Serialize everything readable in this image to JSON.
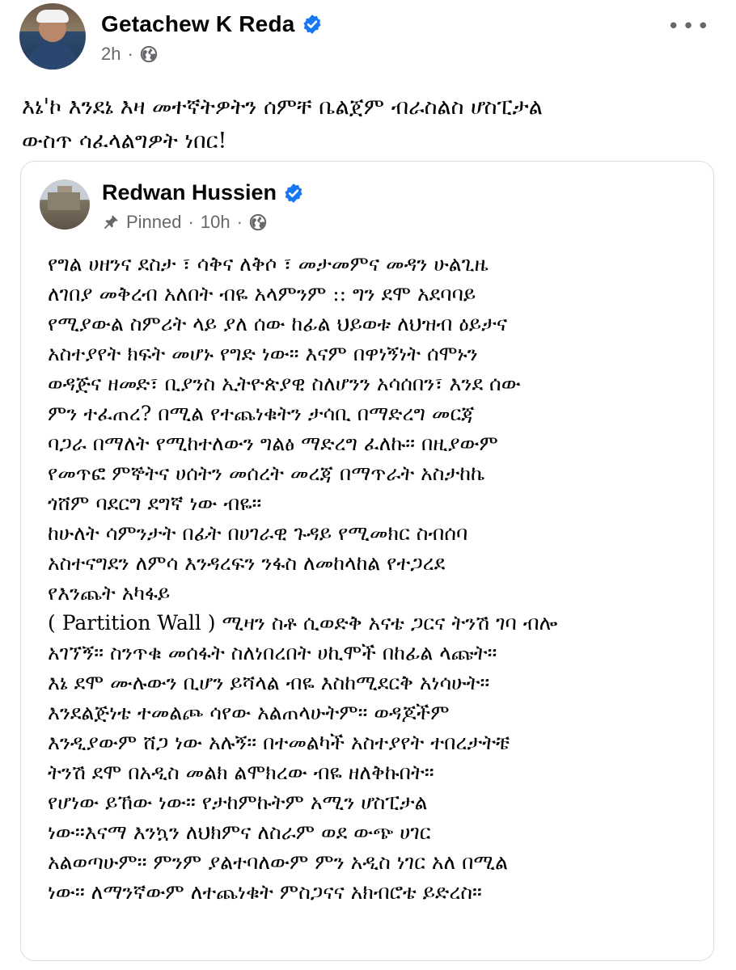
{
  "post": {
    "author": "Getachew K Reda",
    "time": "2h",
    "separator": "·",
    "more": "•••",
    "text": "እኔ'ኮ እንደኔ እዛ መተኛትዎትን ሰምቸ ቤልጀም ብራስልስ ሆስፒታል\nውስጥ ሳፈላልግዎት ነበር!"
  },
  "shared": {
    "author": "Redwan Hussien",
    "pinned": "Pinned",
    "time": "10h",
    "separator": "·",
    "text": "የግል ሀዘንና ደስታ ፣ ሳቅና ለቅሶ ፣ መታመምና መዳን ሁልጊዜ\nለገበያ መቅረብ አለበት ብዬ አላምንም :: ግን ደሞ አደባባይ\nየሚያውል ስምሪት ላይ ያለ ሰው ከፊል ህይወቱ ለህዝብ ዕይታና\nአስተያየት ክፍት መሆኑ የግድ ነው፡፡ እናም በዋነኝነት ሰሞኑን\nወዳጅና ዘመድ፣ ቢያንስ ኢትዮጵያዊ ስለሆንን አሳሰበን፣ እንደ ሰው\nምን ተፈጠረ? በሚል የተጨነቁትን ታሳቢ በማድረግ መርጃ\nባጋራ በማለት የሚከተለውን ግልፅ ማድረግ ፈለኩ፡፡ በዚያውም\nየመጥፎ ምኞትና ሀሰትን መሰረት መረጃ በማጥራት አስታከኬ\nጎሸም ባደርግ ደግኛ ነው ብዬ፡፡\nከሁለት ሳምንታት በፊት በሀገራዊ ጉዳይ የሚመክር ስብሰባ\nአስተናግደን ለምሳ እንዳረፍን ንፋስ ለመከላከል የተጋረደ\nየእንጨት አካፋይ\n ( Partition Wall ) ሚዛን ስቶ ሲወድቅ አናቴ ጋርና ትንሽ ገባ ብሎ\nአገኘኝ፡፡ ስንጥቁ መሰፋት ስለነበረበት ሀኪሞች በከፊል ላጩት፡፡\nእኔ ደሞ ሙሉውን ቢሆን ይሻላል ብዬ እስከሚደርቅ አነሳሁት፡፡\nእንደልጅነቴ ተመልጮ ሳየው አልጠላሁትም፡፡ ወዳጆችም\nእንዲያውም ሸጋ ነው አሉኝ፡፡ በተመልካች አስተያየት ተበረታትቼ\nትንሽ ደሞ በአዲስ መልክ ልሞክረው ብዬ ዘለቅኩበት፡፡\nየሆነው ይኸው ነው፡፡ የታከምኩትም አሚን ሆስፒታል\nነው፡፡እናማ እንኳን ለህክምና ለስራም ወደ ውጭ ሀገር\nአልወጣሁም፡፡ ምንም ያልተባለውም ምን አዲስ ነገር አለ በሚል\nነው፡፡ ለማንኛውም ለተጨነቁት ምስጋናና አክብሮቴ ይድረስ፡፡"
  },
  "colors": {
    "verified": "#1877f2",
    "meta": "#65676b",
    "border": "#dadde1"
  }
}
